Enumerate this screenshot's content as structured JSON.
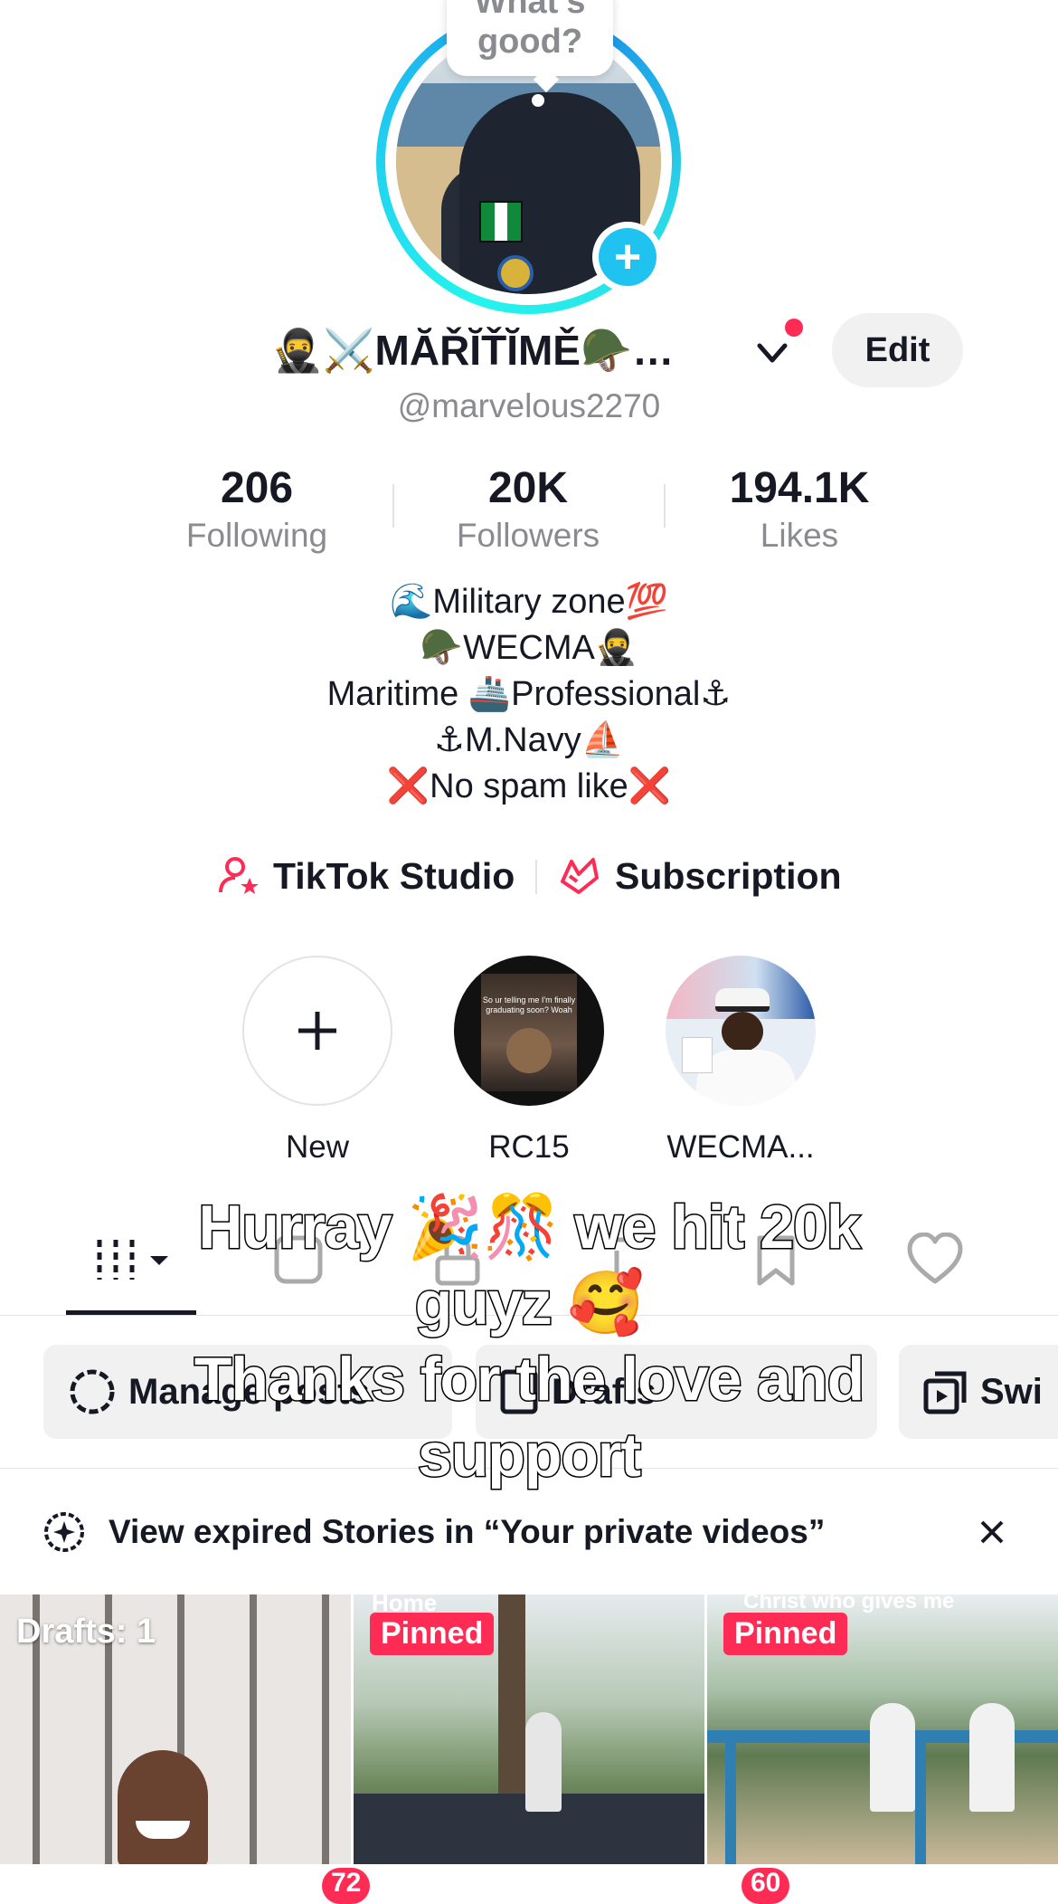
{
  "avatar": {
    "bubble_text_line1": "What's",
    "bubble_text_line2": "good?"
  },
  "profile": {
    "display_name": "🥷⚔️MĂŘĬŤĬMĚ🪖…",
    "handle": "@marvelous2270",
    "edit_label": "Edit"
  },
  "stats": [
    {
      "value": "206",
      "label": "Following"
    },
    {
      "value": "20K",
      "label": "Followers"
    },
    {
      "value": "194.1K",
      "label": "Likes"
    }
  ],
  "bio": {
    "line1": "🌊Military zone💯",
    "line2": "🪖WECMA🥷",
    "line3": "Maritime 🚢Professional⚓",
    "line4": "⚓M.Navy⛵",
    "line5": "❌No spam like❌"
  },
  "links": {
    "studio": "TikTok Studio",
    "subscription": "Subscription"
  },
  "highlights": [
    {
      "label": "New"
    },
    {
      "label": "RC15",
      "thumb_text": "So ur telling me I'm finally graduating soon? Woah"
    },
    {
      "label": "WECMA..."
    }
  ],
  "chips": {
    "chip1": "Manage posts",
    "chip2": "Drafts",
    "chip3": "Swi"
  },
  "overlay_caption": {
    "line1": "Hurray 🎉🎊 we hit 20k",
    "line2": "guyz 🥰",
    "line3": "Thanks for the love and",
    "line4": "support"
  },
  "notice": {
    "text": "View expired Stories in “Your private videos”"
  },
  "grid": [
    {
      "tag": "Drafts: 1"
    },
    {
      "tag": "Pinned",
      "top_text": "Home"
    },
    {
      "tag": "Pinned",
      "top_text": "Christ who gives me"
    }
  ],
  "bottom_badges": [
    "72",
    "60"
  ],
  "colors": {
    "accent": "#fe2c55",
    "ring": "#25f4ee",
    "text": "#161823",
    "muted": "#8a8b91"
  }
}
